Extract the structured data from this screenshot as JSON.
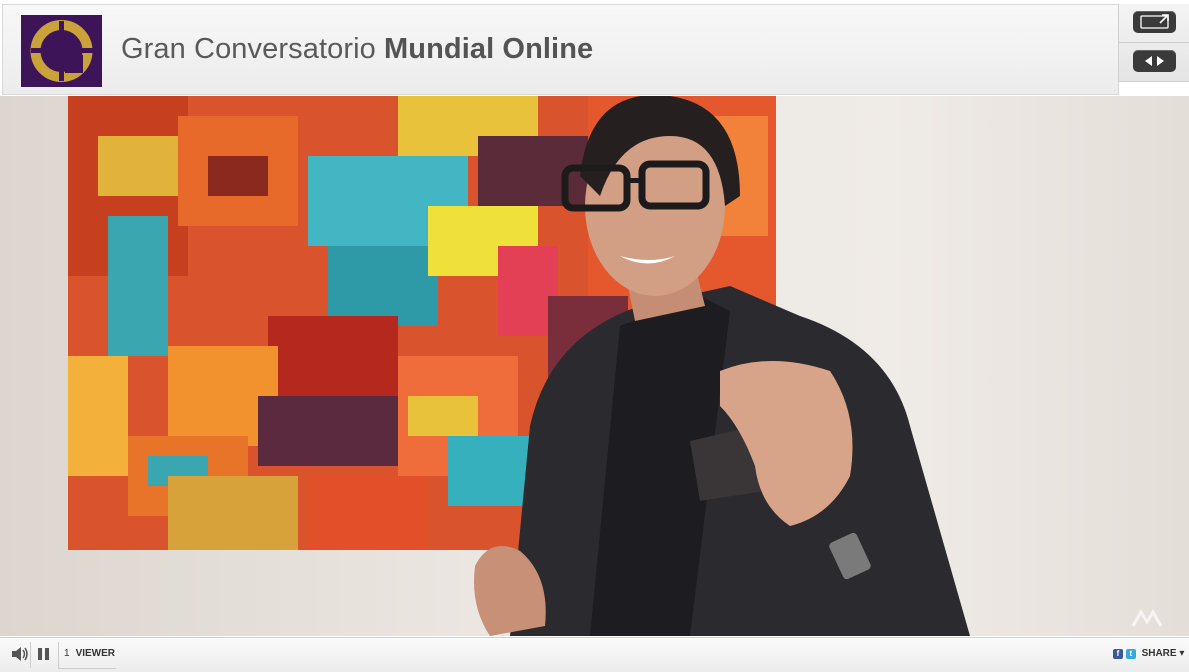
{
  "header": {
    "title_regular": "Gran Conversatorio",
    "title_bold": "Mundial Online"
  },
  "controls": {
    "top_button_icon": "expand-icon",
    "bottom_button_icon": "arrows-left-right-icon"
  },
  "player": {
    "viewer_count": "1",
    "viewer_label": "VIEWER",
    "share_label": "SHARE",
    "share_caret": "▾",
    "facebook_glyph": "f",
    "twitter_glyph": "t"
  },
  "colors": {
    "logo_bg": "#3e1459",
    "logo_gold": "#c9a23a",
    "title": "#5a5a5a",
    "control_button": "#3a3a3a"
  }
}
